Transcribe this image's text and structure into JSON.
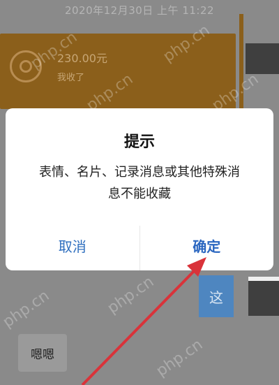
{
  "timestamp": "2020年12月30日 上午 11:22",
  "transfer": {
    "amount": "230.00元",
    "note": "我收了"
  },
  "chat": {
    "blue_bubble_text": "这",
    "left_bubble_text": "嗯嗯"
  },
  "dialog": {
    "title": "提示",
    "message_line1": "表情、名片、记录消息或其他特殊消",
    "message_line2": "息不能收藏",
    "cancel_label": "取消",
    "confirm_label": "确定"
  },
  "watermark_text": "php.cn",
  "colors": {
    "overlay": "#8a8a8a",
    "transfer_card": "#8b5f1b",
    "button_text": "#2f6fbf",
    "arrow": "#d9333a"
  }
}
